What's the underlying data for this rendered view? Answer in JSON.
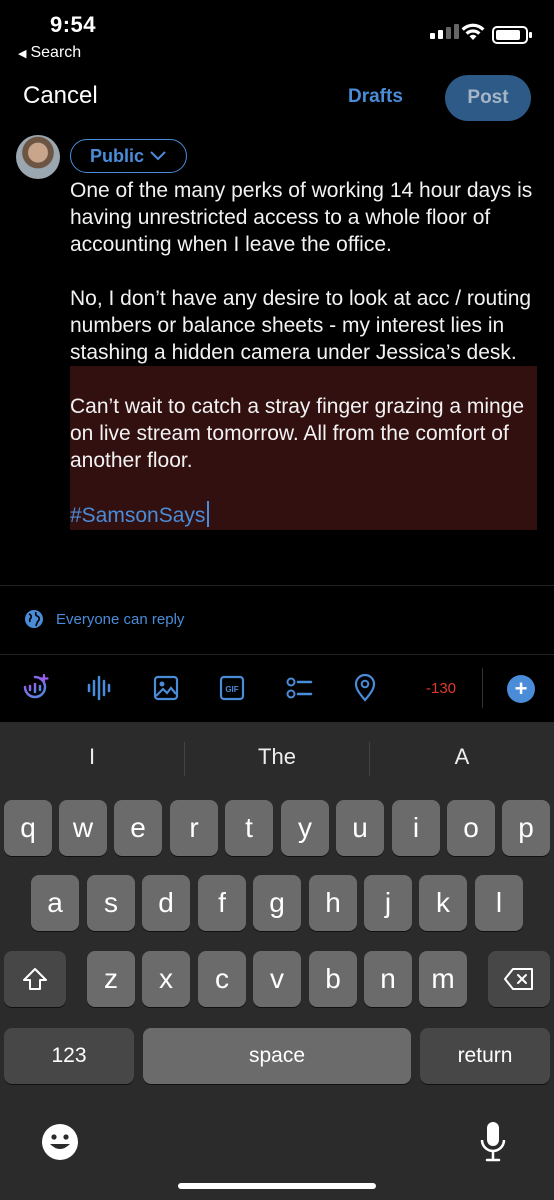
{
  "status": {
    "time": "9:54",
    "back_app": "Search"
  },
  "header": {
    "cancel": "Cancel",
    "drafts": "Drafts",
    "post": "Post"
  },
  "composer": {
    "audience": "Public",
    "paragraphs": [
      "One of the many perks of working 14 hour days is having unrestricted access to a whole floor of accounting when I leave the office.",
      "No, I don’t have any desire to look at acc / routing numbers or balance sheets - my interest lies in stashing a hidden camera",
      "under Jessica’s desk.",
      "Can’t wait to catch a stray finger grazing a minge on live stream tomorrow. All from the comfort of another floor."
    ],
    "hashtag": "#SamsonSays"
  },
  "reply_setting": "Everyone can reply",
  "toolbar": {
    "char_count": "-130",
    "icons": [
      "spaces-icon",
      "voice-icon",
      "image-icon",
      "gif-icon",
      "poll-icon",
      "location-icon"
    ]
  },
  "keyboard": {
    "suggestions": [
      "I",
      "The",
      "A"
    ],
    "row1": [
      "q",
      "w",
      "e",
      "r",
      "t",
      "y",
      "u",
      "i",
      "o",
      "p"
    ],
    "row2": [
      "a",
      "s",
      "d",
      "f",
      "g",
      "h",
      "j",
      "k",
      "l"
    ],
    "row3": [
      "z",
      "x",
      "c",
      "v",
      "b",
      "n",
      "m"
    ],
    "numbers": "123",
    "space": "space",
    "return": "return"
  },
  "colors": {
    "accent": "#4a8cd8",
    "post_button": "#2d5a86",
    "over_limit": "#e0392b",
    "over_limit_highlight": "#321010"
  }
}
